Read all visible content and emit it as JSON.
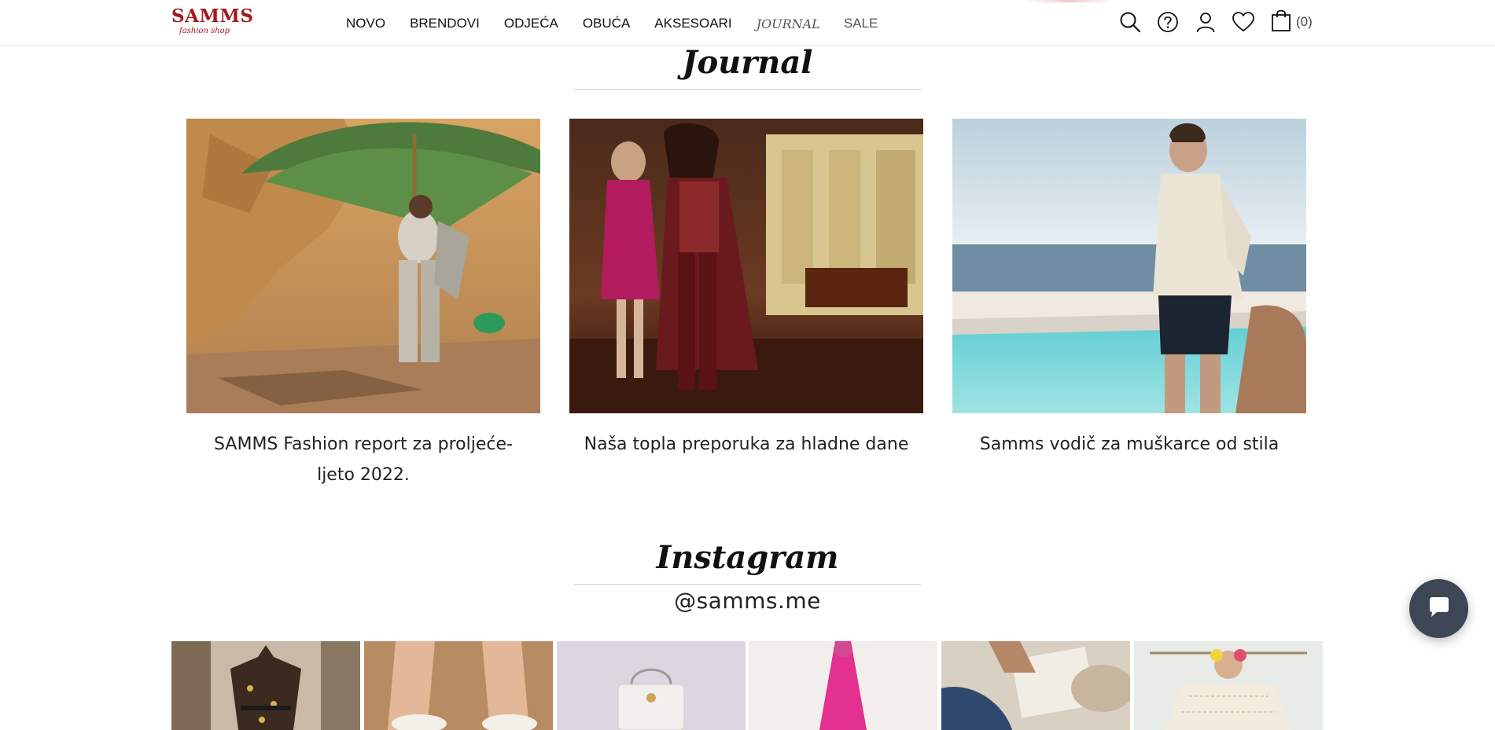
{
  "header": {
    "logo_main": "SAMMS",
    "logo_sub": "fashion shop",
    "nav": [
      {
        "label": "NOVO"
      },
      {
        "label": "BRENDOVI"
      },
      {
        "label": "ODJEĆA"
      },
      {
        "label": "OBUĆA"
      },
      {
        "label": "AKSESOARI"
      },
      {
        "label": "JOURNAL"
      },
      {
        "label": "SALE"
      }
    ],
    "icons": [
      "search-icon",
      "help-icon",
      "user-icon",
      "heart-icon",
      "bag-icon"
    ],
    "cart_count": "(0)"
  },
  "journal": {
    "title": "Journal",
    "articles": [
      {
        "title": "SAMMS Fashion report za proljeće-ljeto 2022."
      },
      {
        "title": "Naša topla preporuka za hladne dane"
      },
      {
        "title": "Samms vodič za muškarce od stila"
      }
    ]
  },
  "instagram": {
    "title": "Instagram",
    "handle": "@samms.me"
  },
  "chat": {
    "icon": "chat-icon"
  },
  "colors": {
    "brand": "#a3191d",
    "chat_bg": "#3e4756"
  }
}
